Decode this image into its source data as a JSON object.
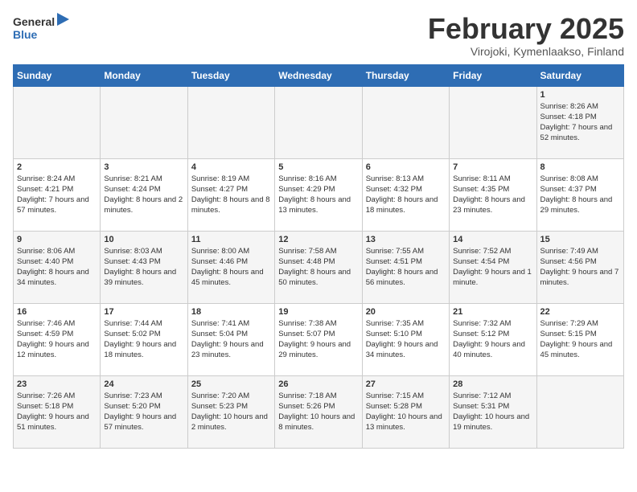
{
  "header": {
    "logo_general": "General",
    "logo_blue": "Blue",
    "title": "February 2025",
    "subtitle": "Virojoki, Kymenlaakso, Finland"
  },
  "weekdays": [
    "Sunday",
    "Monday",
    "Tuesday",
    "Wednesday",
    "Thursday",
    "Friday",
    "Saturday"
  ],
  "weeks": [
    [
      {
        "day": "",
        "info": ""
      },
      {
        "day": "",
        "info": ""
      },
      {
        "day": "",
        "info": ""
      },
      {
        "day": "",
        "info": ""
      },
      {
        "day": "",
        "info": ""
      },
      {
        "day": "",
        "info": ""
      },
      {
        "day": "1",
        "info": "Sunrise: 8:26 AM\nSunset: 4:18 PM\nDaylight: 7 hours and 52 minutes."
      }
    ],
    [
      {
        "day": "2",
        "info": "Sunrise: 8:24 AM\nSunset: 4:21 PM\nDaylight: 7 hours and 57 minutes."
      },
      {
        "day": "3",
        "info": "Sunrise: 8:21 AM\nSunset: 4:24 PM\nDaylight: 8 hours and 2 minutes."
      },
      {
        "day": "4",
        "info": "Sunrise: 8:19 AM\nSunset: 4:27 PM\nDaylight: 8 hours and 8 minutes."
      },
      {
        "day": "5",
        "info": "Sunrise: 8:16 AM\nSunset: 4:29 PM\nDaylight: 8 hours and 13 minutes."
      },
      {
        "day": "6",
        "info": "Sunrise: 8:13 AM\nSunset: 4:32 PM\nDaylight: 8 hours and 18 minutes."
      },
      {
        "day": "7",
        "info": "Sunrise: 8:11 AM\nSunset: 4:35 PM\nDaylight: 8 hours and 23 minutes."
      },
      {
        "day": "8",
        "info": "Sunrise: 8:08 AM\nSunset: 4:37 PM\nDaylight: 8 hours and 29 minutes."
      }
    ],
    [
      {
        "day": "9",
        "info": "Sunrise: 8:06 AM\nSunset: 4:40 PM\nDaylight: 8 hours and 34 minutes."
      },
      {
        "day": "10",
        "info": "Sunrise: 8:03 AM\nSunset: 4:43 PM\nDaylight: 8 hours and 39 minutes."
      },
      {
        "day": "11",
        "info": "Sunrise: 8:00 AM\nSunset: 4:46 PM\nDaylight: 8 hours and 45 minutes."
      },
      {
        "day": "12",
        "info": "Sunrise: 7:58 AM\nSunset: 4:48 PM\nDaylight: 8 hours and 50 minutes."
      },
      {
        "day": "13",
        "info": "Sunrise: 7:55 AM\nSunset: 4:51 PM\nDaylight: 8 hours and 56 minutes."
      },
      {
        "day": "14",
        "info": "Sunrise: 7:52 AM\nSunset: 4:54 PM\nDaylight: 9 hours and 1 minute."
      },
      {
        "day": "15",
        "info": "Sunrise: 7:49 AM\nSunset: 4:56 PM\nDaylight: 9 hours and 7 minutes."
      }
    ],
    [
      {
        "day": "16",
        "info": "Sunrise: 7:46 AM\nSunset: 4:59 PM\nDaylight: 9 hours and 12 minutes."
      },
      {
        "day": "17",
        "info": "Sunrise: 7:44 AM\nSunset: 5:02 PM\nDaylight: 9 hours and 18 minutes."
      },
      {
        "day": "18",
        "info": "Sunrise: 7:41 AM\nSunset: 5:04 PM\nDaylight: 9 hours and 23 minutes."
      },
      {
        "day": "19",
        "info": "Sunrise: 7:38 AM\nSunset: 5:07 PM\nDaylight: 9 hours and 29 minutes."
      },
      {
        "day": "20",
        "info": "Sunrise: 7:35 AM\nSunset: 5:10 PM\nDaylight: 9 hours and 34 minutes."
      },
      {
        "day": "21",
        "info": "Sunrise: 7:32 AM\nSunset: 5:12 PM\nDaylight: 9 hours and 40 minutes."
      },
      {
        "day": "22",
        "info": "Sunrise: 7:29 AM\nSunset: 5:15 PM\nDaylight: 9 hours and 45 minutes."
      }
    ],
    [
      {
        "day": "23",
        "info": "Sunrise: 7:26 AM\nSunset: 5:18 PM\nDaylight: 9 hours and 51 minutes."
      },
      {
        "day": "24",
        "info": "Sunrise: 7:23 AM\nSunset: 5:20 PM\nDaylight: 9 hours and 57 minutes."
      },
      {
        "day": "25",
        "info": "Sunrise: 7:20 AM\nSunset: 5:23 PM\nDaylight: 10 hours and 2 minutes."
      },
      {
        "day": "26",
        "info": "Sunrise: 7:18 AM\nSunset: 5:26 PM\nDaylight: 10 hours and 8 minutes."
      },
      {
        "day": "27",
        "info": "Sunrise: 7:15 AM\nSunset: 5:28 PM\nDaylight: 10 hours and 13 minutes."
      },
      {
        "day": "28",
        "info": "Sunrise: 7:12 AM\nSunset: 5:31 PM\nDaylight: 10 hours and 19 minutes."
      },
      {
        "day": "",
        "info": ""
      }
    ]
  ]
}
